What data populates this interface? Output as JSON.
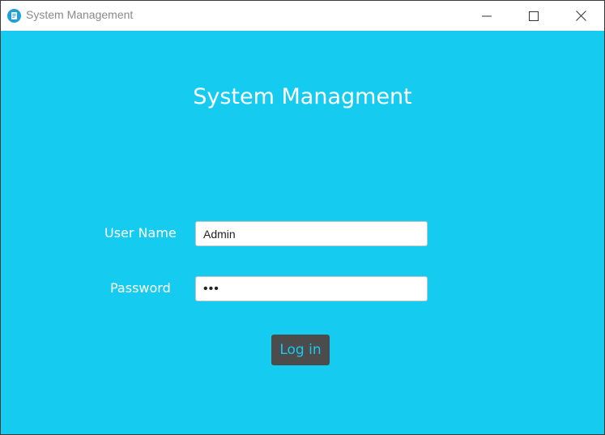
{
  "window": {
    "title": "System Management",
    "app_icon": "notepad-icon",
    "controls": {
      "minimize_icon": "minimize-icon",
      "maximize_icon": "maximize-icon",
      "close_icon": "close-icon"
    }
  },
  "login": {
    "heading": "System Managment",
    "username_label": "User Name",
    "username_value": "Admin",
    "password_label": "Password",
    "password_value": "•••",
    "submit_label": "Log in"
  },
  "colors": {
    "background": "#16cbf0",
    "button_bg": "#4c4c4c",
    "button_text": "#16cbf0",
    "titlebar_bg": "#ffffff"
  }
}
